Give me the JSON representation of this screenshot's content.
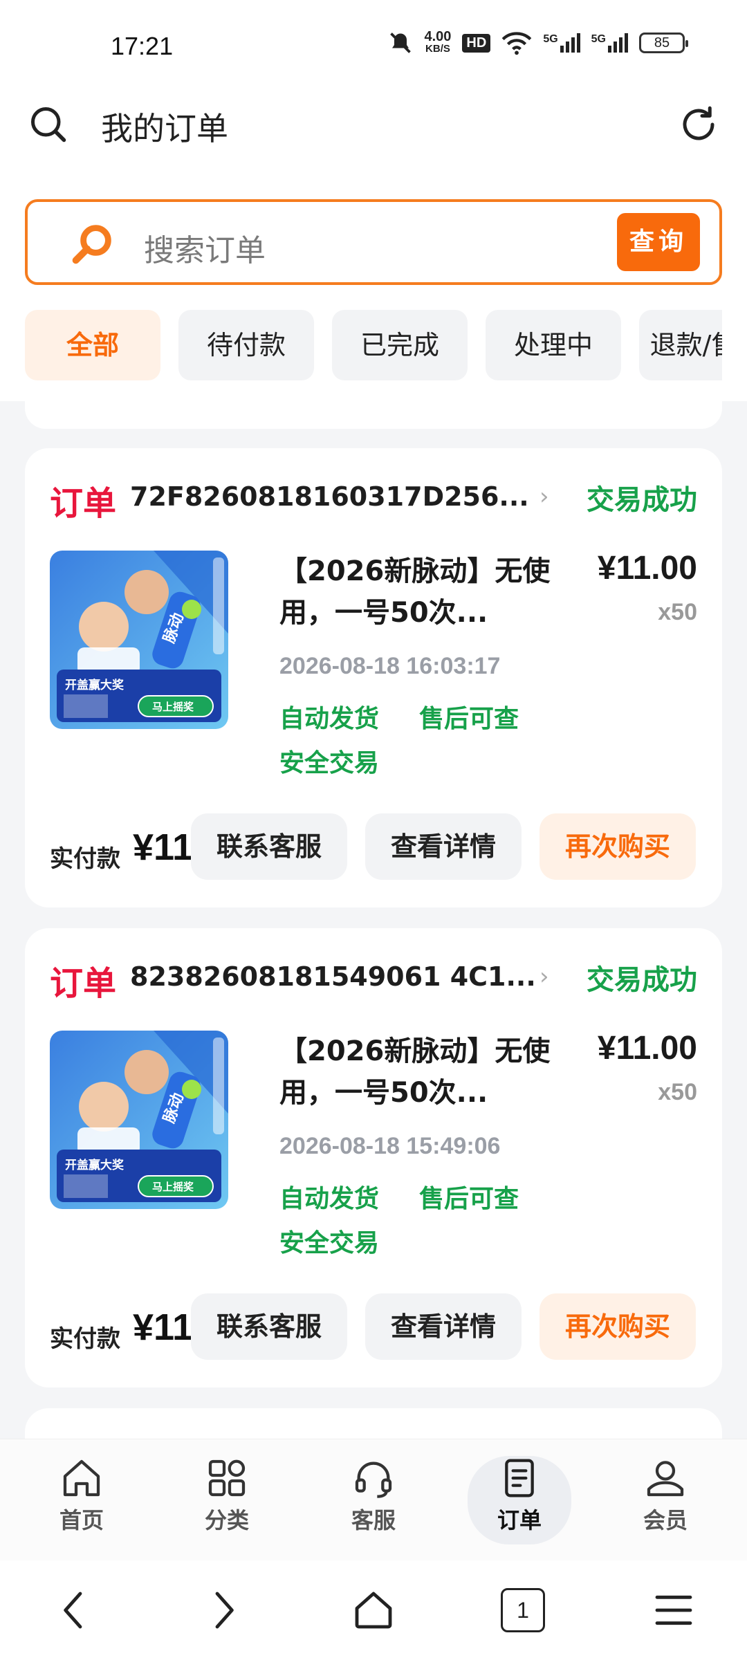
{
  "status_bar": {
    "time": "17:21",
    "net_speed_value": "4.00",
    "net_speed_unit": "KB/S",
    "hd_badge": "HD",
    "signal1": "5G",
    "signal2": "5G",
    "battery": "85"
  },
  "header": {
    "title": "我的订单"
  },
  "search": {
    "placeholder": "搜索订单",
    "button": "查询"
  },
  "tabs": [
    {
      "label": "全部",
      "active": true
    },
    {
      "label": "待付款",
      "active": false
    },
    {
      "label": "已完成",
      "active": false
    },
    {
      "label": "处理中",
      "active": false
    },
    {
      "label": "退款/售后",
      "active": false
    }
  ],
  "orders": [
    {
      "label": "订单",
      "order_no": "72F8260818160317D256...",
      "status": "交易成功",
      "product_name": "【2026新脉动】无使用，一号50次...",
      "price": "¥11.00",
      "qty": "x50",
      "time": "2026-08-18 16:03:17",
      "tags": [
        "自动发货",
        "售后可查",
        "安全交易"
      ],
      "paid_label": "实付款",
      "paid_value": "¥11",
      "buttons": {
        "service": "联系客服",
        "detail": "查看详情",
        "rebuy": "再次购买"
      },
      "thumb": {
        "banner": "开盖赢大奖",
        "cta": "马上摇奖",
        "brand": "脉动"
      }
    },
    {
      "label": "订单",
      "order_no": "82382608181549061 4C1...",
      "status": "交易成功",
      "product_name": "【2026新脉动】无使用，一号50次...",
      "price": "¥11.00",
      "qty": "x50",
      "time": "2026-08-18 15:49:06",
      "tags": [
        "自动发货",
        "售后可查",
        "安全交易"
      ],
      "paid_label": "实付款",
      "paid_value": "¥11",
      "buttons": {
        "service": "联系客服",
        "detail": "查看详情",
        "rebuy": "再次购买"
      },
      "thumb": {
        "banner": "开盖赢大奖",
        "cta": "马上摇奖",
        "brand": "脉动"
      }
    }
  ],
  "bottom_nav": [
    {
      "label": "首页",
      "icon": "home-icon"
    },
    {
      "label": "分类",
      "icon": "grid-icon"
    },
    {
      "label": "客服",
      "icon": "headset-icon"
    },
    {
      "label": "订单",
      "icon": "order-list-icon",
      "active": true
    },
    {
      "label": "会员",
      "icon": "user-icon"
    }
  ],
  "system_nav": {
    "tab_count": "1"
  },
  "colors": {
    "accent": "#f86a0c",
    "order_red": "#e8163c",
    "success_green": "#17a14a"
  }
}
